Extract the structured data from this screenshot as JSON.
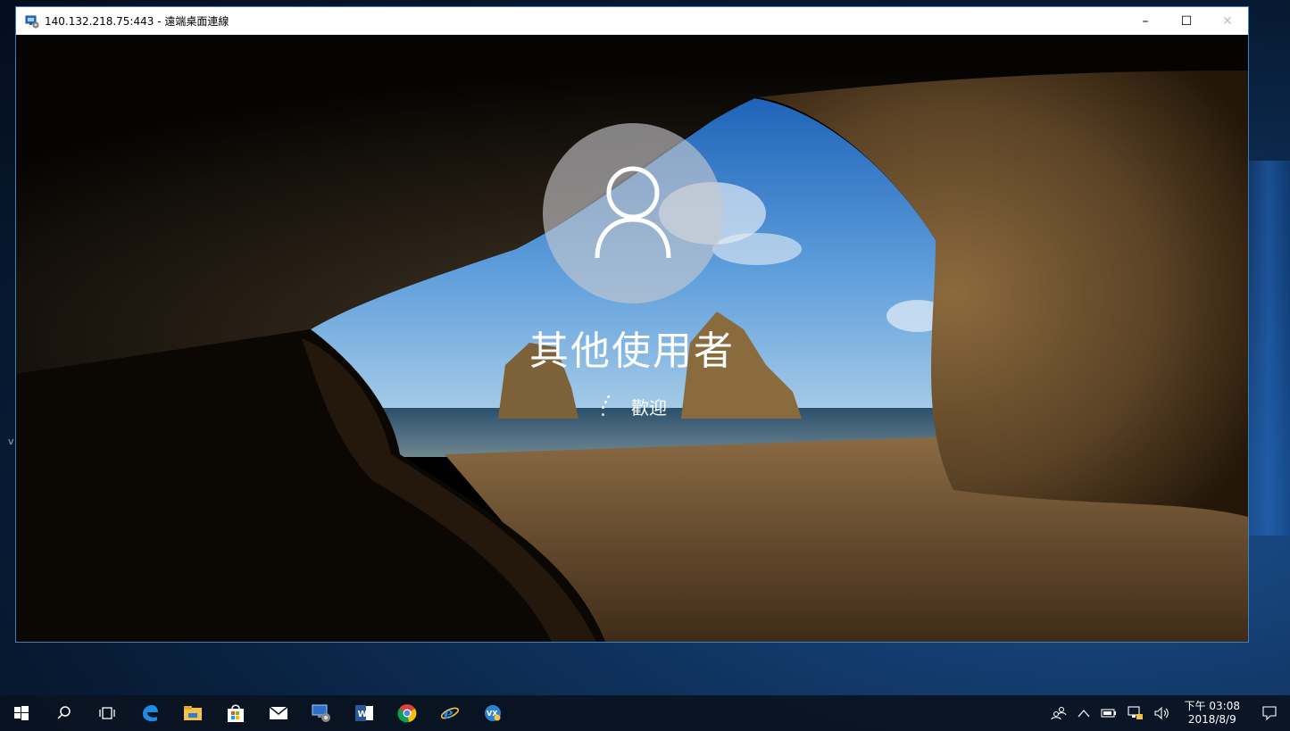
{
  "window": {
    "title": "140.132.218.75:443 - 遠端桌面連線",
    "controls": {
      "minimize": "–",
      "maximize": "☐",
      "close": "✕"
    }
  },
  "lock_screen": {
    "username": "其他使用者",
    "status": "歡迎",
    "avatar_icon": "user-icon"
  },
  "taskbar": {
    "pinned": [
      "windows-start-icon",
      "search-icon",
      "task-view-icon",
      "edge-icon",
      "file-explorer-icon",
      "store-icon",
      "mail-icon",
      "remote-desktop-icon",
      "word-icon",
      "chrome-icon",
      "internet-explorer-icon",
      "vx-app-icon"
    ],
    "clock": {
      "time": "下午 03:08",
      "date": "2018/8/9"
    }
  },
  "desktop": {
    "left_caret": "v"
  },
  "colors": {
    "accent": "#3c7fc5",
    "edge_blue": "#1e8be6",
    "store_yellow": "#f4c246"
  }
}
